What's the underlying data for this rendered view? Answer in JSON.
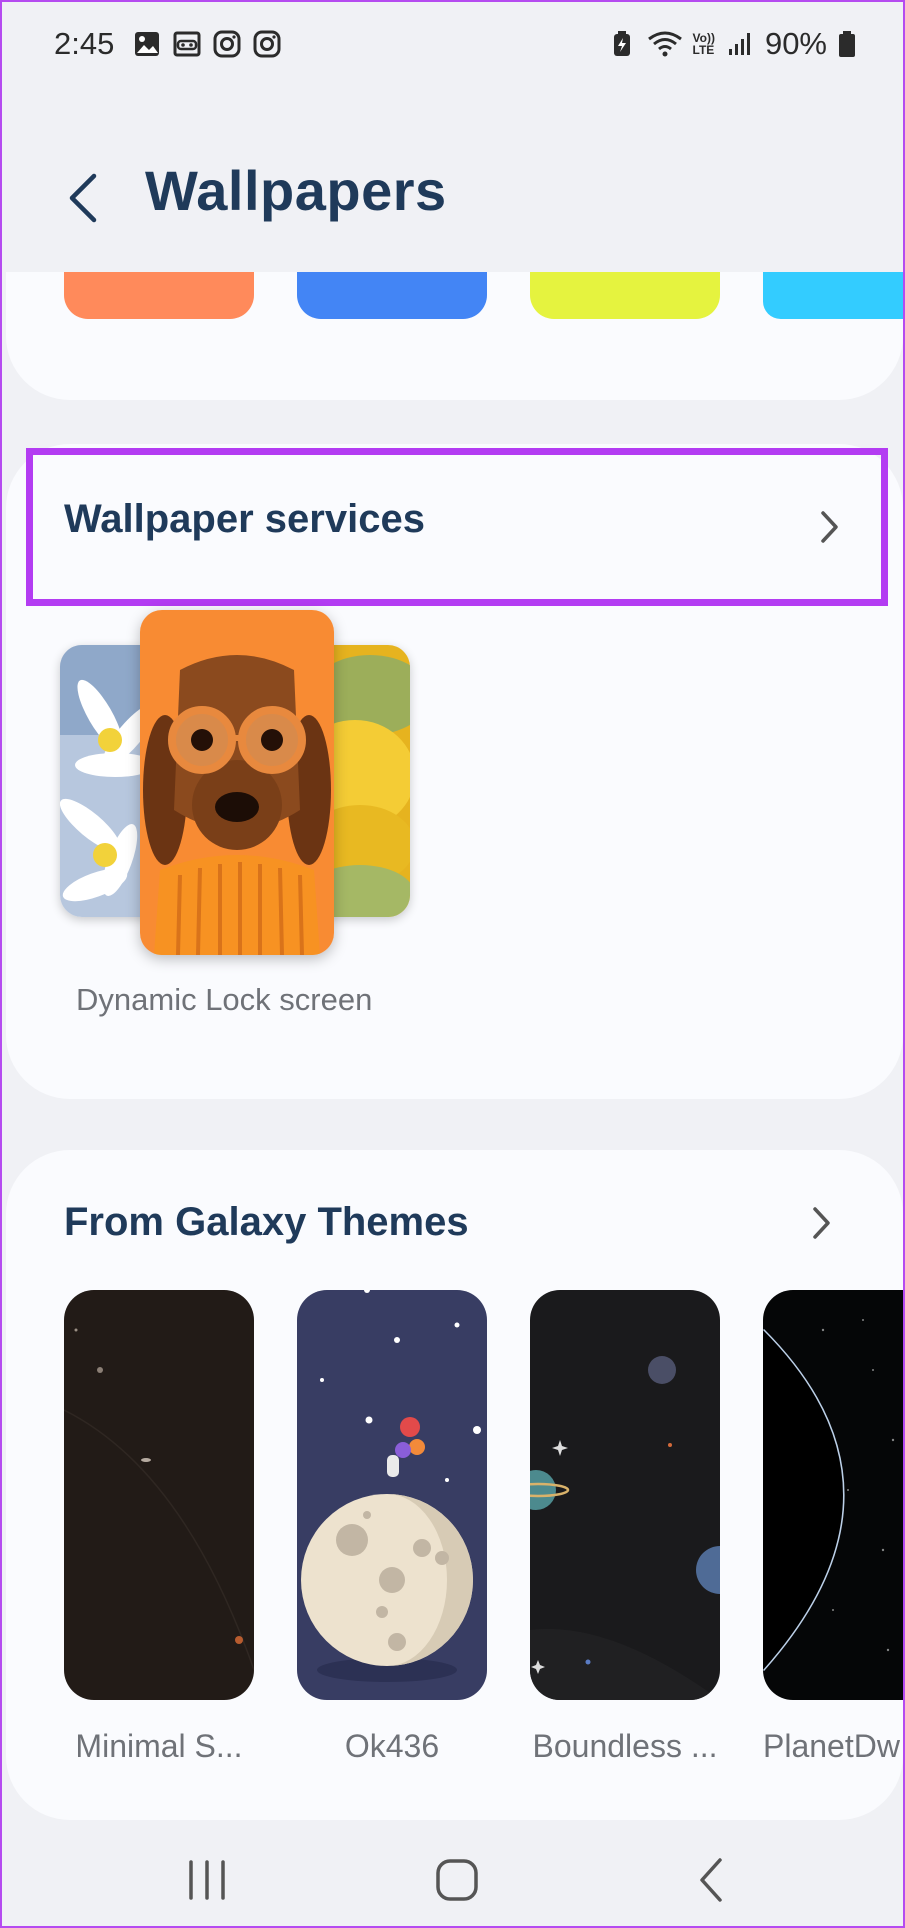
{
  "status": {
    "time": "2:45",
    "battery_text": "90%",
    "network_label_top": "Vo))",
    "network_label_bottom": "LTE"
  },
  "header": {
    "title": "Wallpapers",
    "back_icon": "chevron-left-icon"
  },
  "color_swatches": [
    "#ff8a5b",
    "#4385f5",
    "#e5f33f",
    "#33ccff"
  ],
  "services": {
    "title": "Wallpaper services",
    "dynamic_lock_caption": "Dynamic Lock screen"
  },
  "themes": {
    "title": "From Galaxy Themes",
    "items": [
      {
        "name": "Minimal S..."
      },
      {
        "name": "Ok436"
      },
      {
        "name": "Boundless ..."
      },
      {
        "name": "PlanetDw"
      }
    ]
  },
  "colors": {
    "title": "#1f3a5a",
    "highlight": "#b33cf2",
    "background": "#f0f1f5",
    "card": "#fafbfe"
  },
  "nav": {
    "recent_icon": "recent-apps-icon",
    "home_icon": "home-icon",
    "back_icon": "back-icon"
  }
}
